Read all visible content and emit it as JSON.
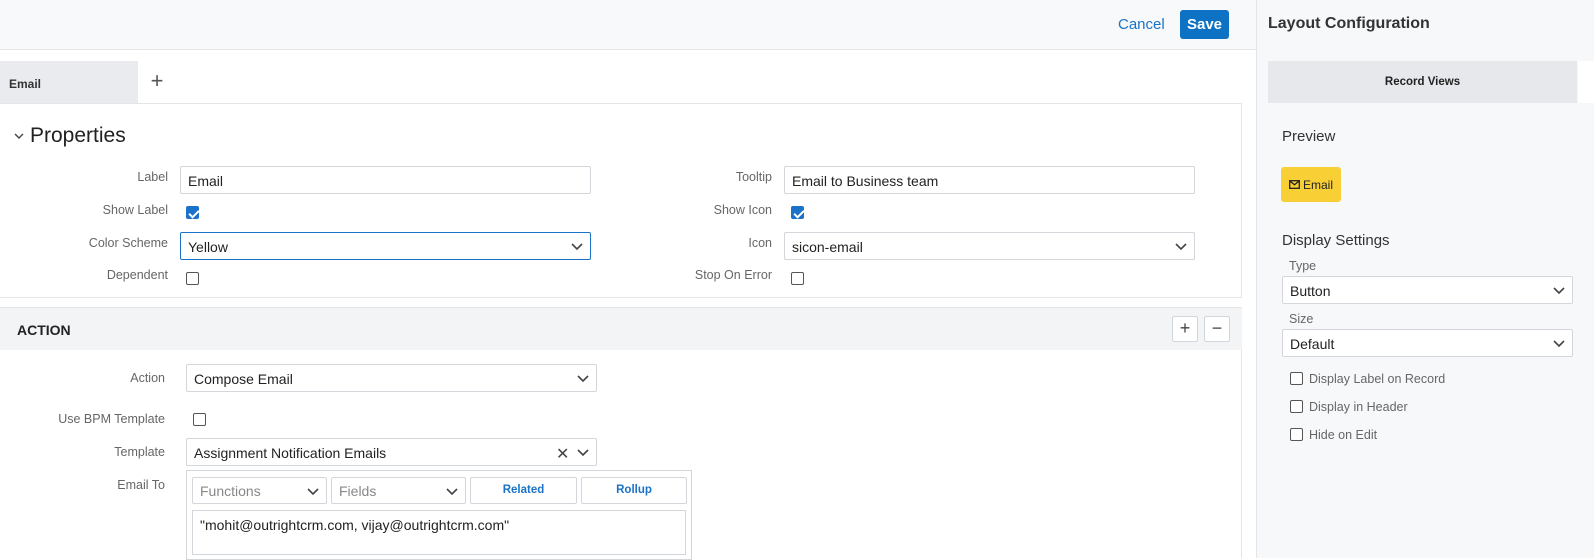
{
  "topbar": {
    "cancel_label": "Cancel",
    "save_label": "Save"
  },
  "tabs": [
    {
      "label": "Email"
    }
  ],
  "tab_add_symbol": "+",
  "properties": {
    "title": "Properties",
    "label_label": "Label",
    "label_value": "Email",
    "tooltip_label": "Tooltip",
    "tooltip_value": "Email to Business team",
    "show_label_label": "Show Label",
    "show_label_checked": true,
    "show_icon_label": "Show Icon",
    "show_icon_checked": true,
    "color_scheme_label": "Color Scheme",
    "color_scheme_value": "Yellow",
    "icon_label": "Icon",
    "icon_value": "sicon-email",
    "dependent_label": "Dependent",
    "dependent_checked": false,
    "stop_on_error_label": "Stop On Error",
    "stop_on_error_checked": false
  },
  "action": {
    "title": "ACTION",
    "add_symbol": "+",
    "remove_symbol": "−",
    "action_label": "Action",
    "action_value": "Compose Email",
    "bpm_label": "Use BPM Template",
    "bpm_checked": false,
    "template_label": "Template",
    "template_value": "Assignment Notification Emails",
    "clear_symbol": "✕",
    "email_to_label": "Email To",
    "functions_placeholder": "Functions",
    "fields_placeholder": "Fields",
    "related_label": "Related",
    "rollup_label": "Rollup",
    "email_to_value": "\"mohit@outrightcrm.com, vijay@outrightcrm.com\""
  },
  "right_panel": {
    "title": "Layout Configuration",
    "tab_label": "Record Views",
    "preview_title": "Preview",
    "preview_button_label": "Email",
    "display_settings_title": "Display Settings",
    "type_label": "Type",
    "type_value": "Button",
    "size_label": "Size",
    "size_value": "Default",
    "options": [
      {
        "label": "Display Label on Record",
        "checked": false
      },
      {
        "label": "Display in Header",
        "checked": false
      },
      {
        "label": "Hide on Edit",
        "checked": false
      }
    ]
  },
  "colors": {
    "accent": "#0e72c4",
    "link": "#1a73c8",
    "preview_yellow": "#f8cf35"
  }
}
